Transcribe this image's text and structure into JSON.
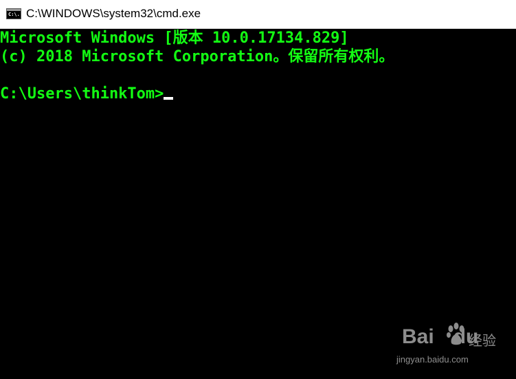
{
  "window": {
    "title": "C:\\WINDOWS\\system32\\cmd.exe",
    "icon": "cmd-console-icon",
    "icon_text": "C:\\."
  },
  "console": {
    "text_color": "#13ff13",
    "background": "#000000",
    "lines": [
      "Microsoft Windows [版本 10.0.17134.829]",
      "(c) 2018 Microsoft Corporation。保留所有权利。",
      "",
      "C:\\Users\\thinkTom>"
    ]
  },
  "watermark": {
    "logo": "Bai",
    "logo_tail": "du",
    "chinese": "经验",
    "url": "jingyan.baidu.com",
    "icon": "baidu-paw-icon"
  }
}
